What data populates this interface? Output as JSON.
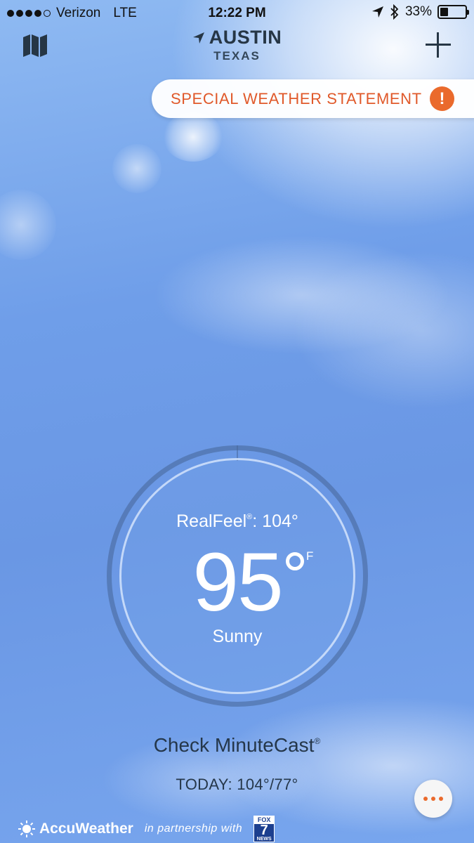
{
  "status_bar": {
    "carrier": "Verizon",
    "network": "LTE",
    "time": "12:22 PM",
    "battery_percent": "33%",
    "battery_level": 0.33,
    "icons": [
      "location-arrow-icon",
      "bluetooth-icon",
      "battery-icon"
    ]
  },
  "header": {
    "city": "AUSTIN",
    "state": "TEXAS",
    "map_icon": "map-icon",
    "add_icon": "plus-icon"
  },
  "alert": {
    "label": "SPECIAL WEATHER STATEMENT",
    "icon_text": "!",
    "color": "#e0592a"
  },
  "current": {
    "realfeel_label": "RealFeel",
    "realfeel_mark": "®",
    "realfeel_value": ": 104°",
    "temperature": "95",
    "unit": "F",
    "condition": "Sunny"
  },
  "minutecast": {
    "label": "Check MinuteCast",
    "mark": "®"
  },
  "today": {
    "label": "TODAY: 104°/77°"
  },
  "footer": {
    "brand": "AccuWeather",
    "partner_text": "in partnership with",
    "partner_logo": {
      "top": "FOX",
      "number": "7",
      "bottom": "NEWS"
    }
  }
}
